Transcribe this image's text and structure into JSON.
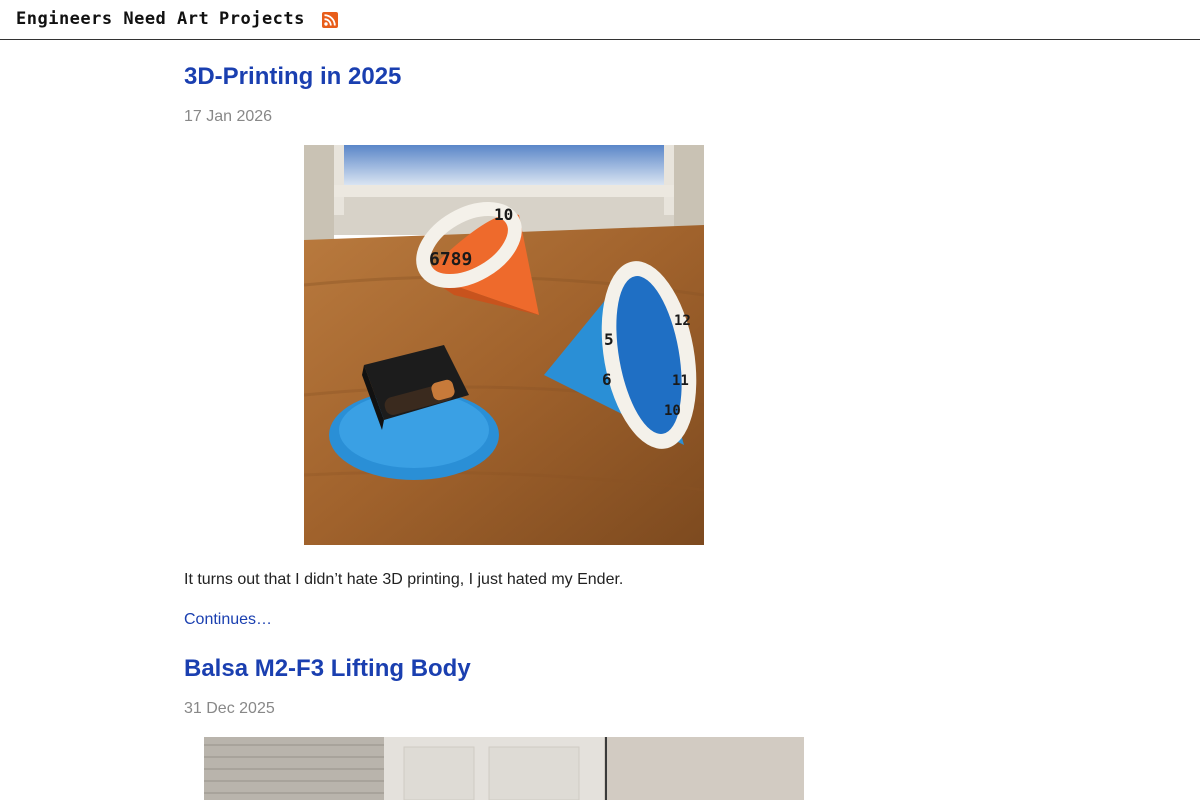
{
  "header": {
    "site_title": "Engineers Need Art",
    "nav_projects": "Projects",
    "rss_icon": "rss-feed-icon",
    "rss_color": "#e85d1a"
  },
  "posts": [
    {
      "title": "3D-Printing in 2025",
      "date": "17 Jan 2026",
      "image_icon": "photo-3d-printed-cones-and-clock",
      "excerpt": "It turns out that I didn’t hate 3D printing, I just hated my Ender.",
      "continue_label": "Continues…"
    },
    {
      "title": "Balsa M2-F3 Lifting Body",
      "date": "31 Dec 2025",
      "image_icon": "photo-room-interior"
    }
  ],
  "colors": {
    "link": "#1a3fb0",
    "date": "#888888",
    "text": "#222222"
  }
}
